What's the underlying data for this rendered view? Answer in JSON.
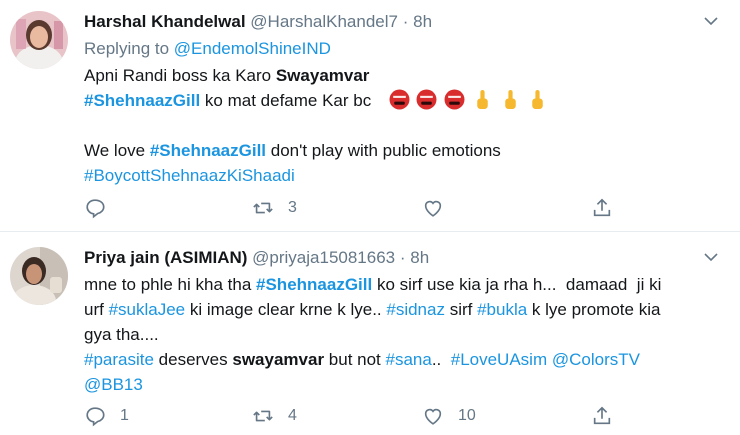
{
  "tweets": [
    {
      "name": "Harshal Khandelwal",
      "handle": "@HarshalKhandel7",
      "time": "8h",
      "reply_prefix": "Replying to",
      "reply_to": "@EndemolShineIND",
      "line1_text": "Apni Randi boss ka Karo ",
      "line1_bold": "Swayamvar",
      "line2_hashtag": "#ShehnaazGill",
      "line2_text": " ko mat defame Kar bc",
      "line3_text": "We love ",
      "line3_hashtag": "#ShehnaazGill",
      "line3_rest": " don't play with public emotions",
      "line4_hashtag": "#BoycottShehnaazKiShaadi",
      "emojis": [
        "angry-face-icon",
        "angry-face-icon",
        "angry-face-icon",
        "pointing-up-icon",
        "pointing-up-icon",
        "pointing-up-icon"
      ],
      "replies": "",
      "retweets": "3",
      "likes": ""
    },
    {
      "name": "Priya jain (ASIMIAN)",
      "handle": "@priyaja15081663",
      "time": "8h",
      "l1_a": "mne to phle hi kha tha ",
      "l1_hashtag": "#ShehnaazGill",
      "l1_b": " ko sirf use kia ja rha h...  damaad  ji ki",
      "l2_a": "urf ",
      "l2_tag1": "#suklaJee",
      "l2_b": " ki image clear krne k lye.. ",
      "l2_tag2": "#sidnaz",
      "l2_c": " sirf ",
      "l2_tag3": "#bukla",
      "l2_d": " k lye promote kia",
      "l3": "gya tha....",
      "l4_tag1": "#parasite",
      "l4_a": " deserves ",
      "l4_bold": "swayamvar",
      "l4_b": " but not ",
      "l4_tag2": "#sana",
      "l4_c": "..  ",
      "l4_tag3": "#LoveUAsim",
      "l4_d": " ",
      "l4_tag4": "@ColorsTV",
      "l5_tag": "@BB13",
      "replies": "1",
      "retweets": "4",
      "likes": "10"
    }
  ],
  "separator_dot": "·",
  "colors": {
    "link": "#1b95e0",
    "secondary": "#657786",
    "divider": "#e6ecf0"
  }
}
